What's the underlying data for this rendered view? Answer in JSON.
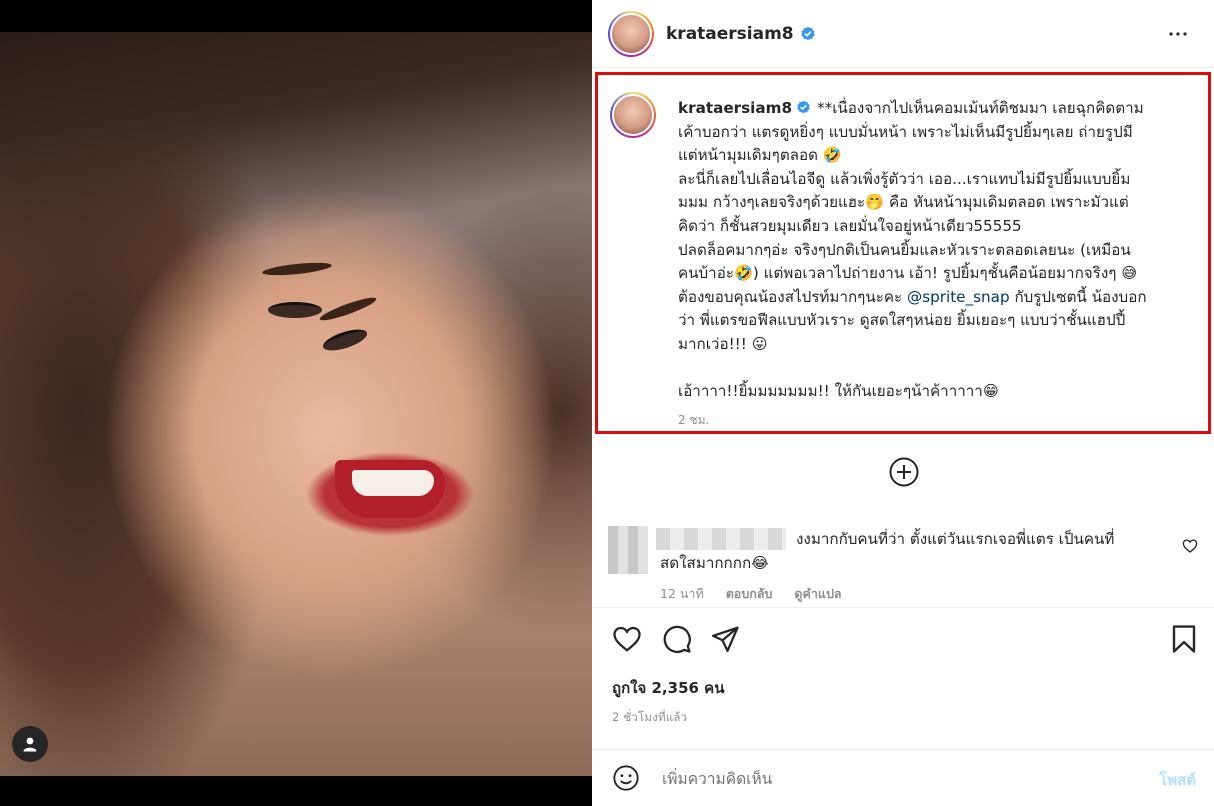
{
  "post": {
    "username": "krataersiam8",
    "verified": true,
    "more_icon": "more-horizontal-icon"
  },
  "caption": {
    "username": "krataersiam8",
    "lines": [
      "**เนื่องจากไปเห็นคอมเม้นท์ติชมมา เลยฉุกคิดตาม",
      "เค้าบอกว่า แตรดูหยิ่งๆ แบบมั่นหน้า เพราะไม่เห็นมีรูปยิ้มๆเลย ถ่ายรูปมี",
      "แต่หน้ามุมเดิมๆตลอด 🤣",
      "ละนี่ก็เลยไปเลื่อนไอจีดู แล้วเพิ่งรู้ตัวว่า เออ...เราแทบไม่มีรูปยิ้มแบบยิ้ม",
      "มมม กว้างๆเลยจริงๆด้วยแฮะ🤭 คือ หันหน้ามุมเดิมตลอด เพราะมัวแต่",
      "คิดว่า ก็ชั้นสวยมุมเดียว เลยมั่นใจอยู่หน้าเดียว55555",
      "ปลดล็อคมากๆอ่ะ จริงๆปกติเป็นคนยิ้มและหัวเราะตลอดเลยนะ (เหมือน",
      "คนบ้าอ่ะ🤣) แต่พอเวลาไปถ่ายงาน เอ้า! รูปยิ้มๆชั้นคือน้อยมากจริงๆ 😅",
      "ต้องขอบคุณน้องสไปรท์มากๆนะคะ",
      "ว่า พี่แตรขอฟีลแบบหัวเราะ ดูสดใสๆหน่อย ยิ้มเยอะๆ แบบว่าชั้นแฮปปี้",
      "มากเว่อ!!! 😛",
      "",
      "เอ้าาาา!!ยิ้มมมมมมม!! ให้กันเยอะๆน้าค้าาาาา😁"
    ],
    "mention": "@sprite_snap",
    "after_mention": "กับรูปเซตนี้ น้องบอก",
    "time": "2 ชม."
  },
  "load_more_icon": "plus-circle-icon",
  "comment": {
    "text_line1": "งงมากกับคนที่ว่า ตั้งแต่วันแรกเจอพี่แตร เป็นคนที่",
    "text_line2": "สดใสมากกกก😂",
    "time": "12 นาที",
    "reply_label": "ตอบกลับ",
    "translate_label": "ดูคำแปล"
  },
  "actions": {
    "like_icon": "heart-icon",
    "comment_icon": "comment-icon",
    "share_icon": "send-icon",
    "save_icon": "bookmark-icon"
  },
  "likes_text": "ถูกใจ 2,356 คน",
  "post_time": "2 ชั่วโมงที่แล้ว",
  "add_comment": {
    "placeholder": "เพิ่มความคิดเห็น",
    "post_label": "โพสต์"
  },
  "colors": {
    "highlight_border": "#e00a0a",
    "verified": "#3897f0",
    "link": "#00376b",
    "post_button_disabled": "#b2dffc"
  }
}
